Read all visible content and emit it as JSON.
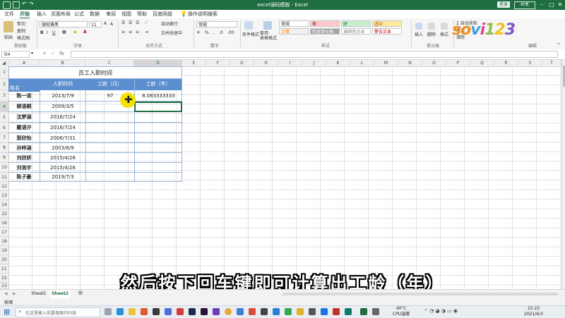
{
  "window": {
    "title": "excel误码模版 - Excel",
    "login": "登录",
    "share": "共享"
  },
  "menu": [
    "文件",
    "开始",
    "插入",
    "页面布局",
    "公式",
    "数据",
    "审阅",
    "视图",
    "帮助",
    "百度网盘",
    "操作说明搜索"
  ],
  "ribbon": {
    "paste": "粘贴",
    "cut": "剪切",
    "copy": "复制",
    "format_painter": "格式刷",
    "font_name": "微软雅黑",
    "font_size": "11",
    "wrap": "自动换行",
    "merge": "合并后居中",
    "number_format": "常规",
    "cond_format": "条件格式",
    "table_format": "套用\n表格格式",
    "styles": {
      "normal": "常规",
      "bad": "差",
      "good": "好",
      "neutral": "适中",
      "calc": "计算",
      "check": "检查单元格",
      "explain": "解释性文本",
      "warn": "警告文本"
    },
    "insert": "插入",
    "delete": "删除",
    "format": "格式",
    "autosum": "自动求和",
    "fill": "填充",
    "clear": "清除",
    "groups": [
      "剪贴板",
      "字体",
      "对齐方式",
      "数字",
      "样式",
      "单元格",
      "编辑"
    ]
  },
  "formula": {
    "name_box": "D4",
    "content": ""
  },
  "columns": [
    "A",
    "B",
    "C",
    "D",
    "E",
    "F",
    "G",
    "H",
    "I",
    "J",
    "K",
    "L",
    "M",
    "N",
    "O",
    "P",
    "Q",
    "R",
    "S",
    "T",
    "U",
    "V",
    "W"
  ],
  "rows": [
    "1",
    "2",
    "3",
    "4",
    "5",
    "6",
    "7",
    "8",
    "9",
    "10",
    "11",
    "12",
    "13",
    "14",
    "15",
    "16",
    "17",
    "18",
    "19",
    "20",
    "21",
    "22",
    "23"
  ],
  "table": {
    "title": "员工入职时间",
    "headers": {
      "name": "姓名",
      "date": "入职时间",
      "months": "工龄（月）",
      "years": "工龄（年）"
    },
    "records": [
      {
        "name": "陈一诺",
        "date": "2013/7/9",
        "months": "97",
        "years": "8.083333333"
      },
      {
        "name": "柳语桐",
        "date": "2009/3/5",
        "months": "",
        "years": ""
      },
      {
        "name": "沈梦涵",
        "date": "2016/7/24",
        "months": "",
        "years": ""
      },
      {
        "name": "戴语汐",
        "date": "2016/7/24",
        "months": "",
        "years": ""
      },
      {
        "name": "郭欣怡",
        "date": "2006/7/31",
        "months": "",
        "years": ""
      },
      {
        "name": "孙梓涵",
        "date": "2003/6/9",
        "months": "",
        "years": ""
      },
      {
        "name": "刘欣妍",
        "date": "2015/4/26",
        "months": "",
        "years": ""
      },
      {
        "name": "刘浩宇",
        "date": "2015/4/26",
        "months": "",
        "years": ""
      },
      {
        "name": "陈子豪",
        "date": "2019/7/3",
        "months": "",
        "years": ""
      }
    ]
  },
  "sheets": [
    "Sheet1",
    "Sheet2"
  ],
  "active_sheet": "Sheet2",
  "status": {
    "mode": "就绪"
  },
  "taskbar": {
    "search_placeholder": "在这里输入你要搜索的内容",
    "temp": "40°C",
    "cpu": "CPU温度",
    "time": "15:23",
    "date": "2021/6/3"
  },
  "subtitle": "然后按下回车键即可计算出工龄（年）",
  "logo": "sovi123",
  "colors": {
    "excel_green": "#1e6e42",
    "header_blue": "#5b8fd0"
  }
}
